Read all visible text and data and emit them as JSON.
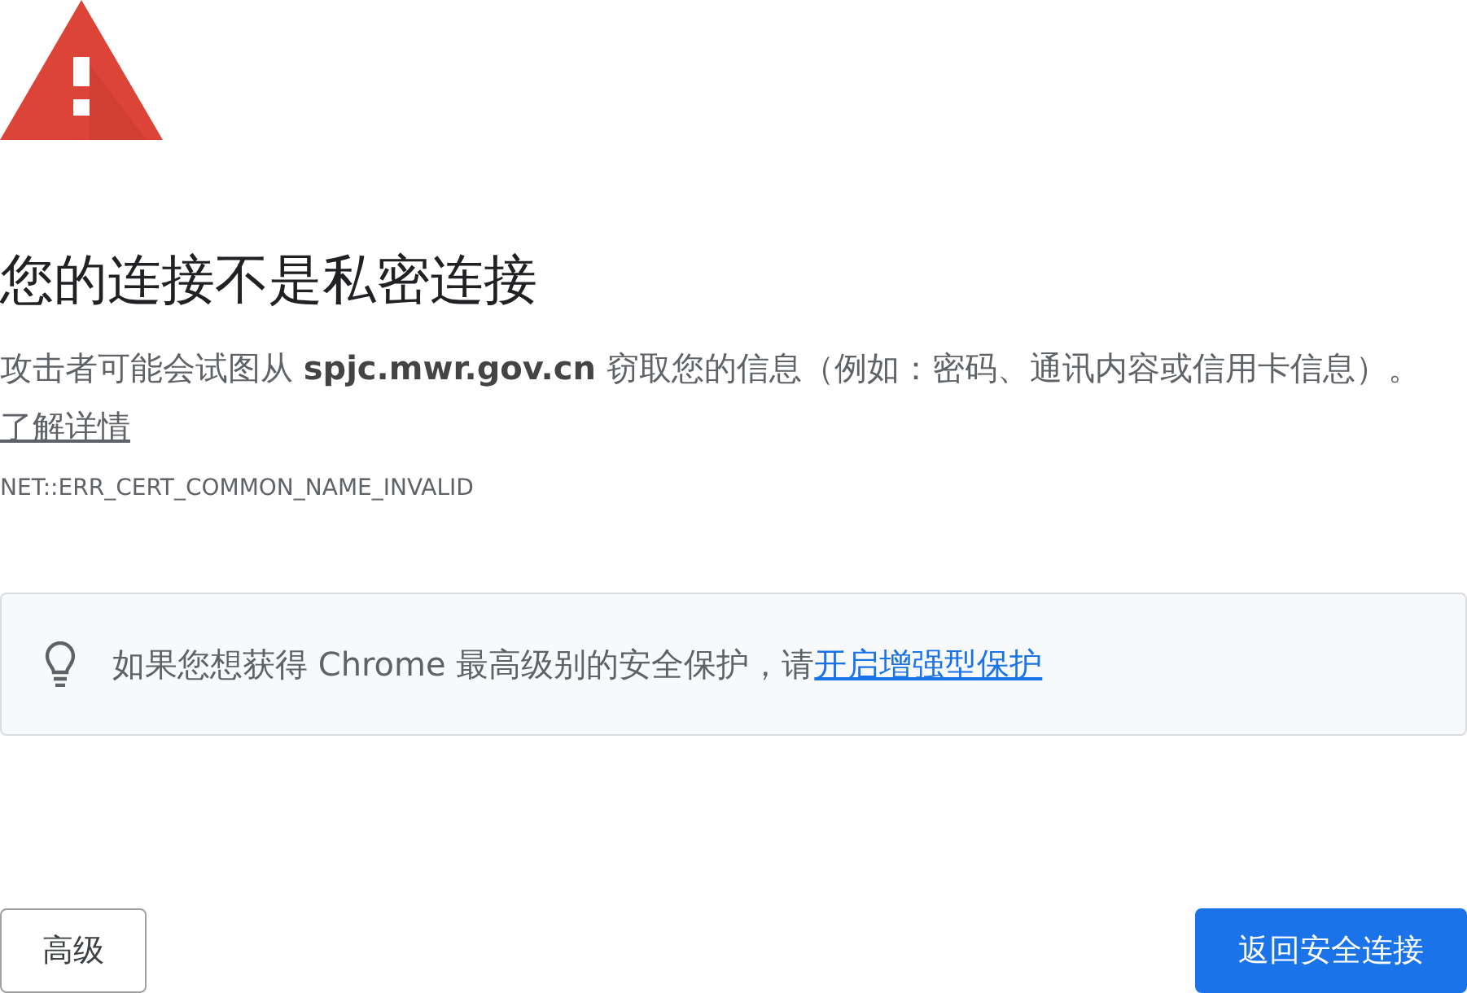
{
  "heading": "您的连接不是私密连接",
  "description": {
    "text": "攻击者可能会试图从 **spjc.mwr.gov.cn** 窃取您的信息（例如：密码、通讯内容或信用卡信息）。",
    "link": "了解详情"
  },
  "error_code": "NET::ERR_CERT_COMMON_NAME_INVALID",
  "tip": {
    "text": "如果您想获得 Chrome 最高级别的安全保护，请",
    "link": "开启增强型保护"
  },
  "buttons": [
    {
      "label": "高级",
      "kind": "secondary"
    },
    {
      "label": "返回安全连接",
      "kind": "primary"
    }
  ]
}
